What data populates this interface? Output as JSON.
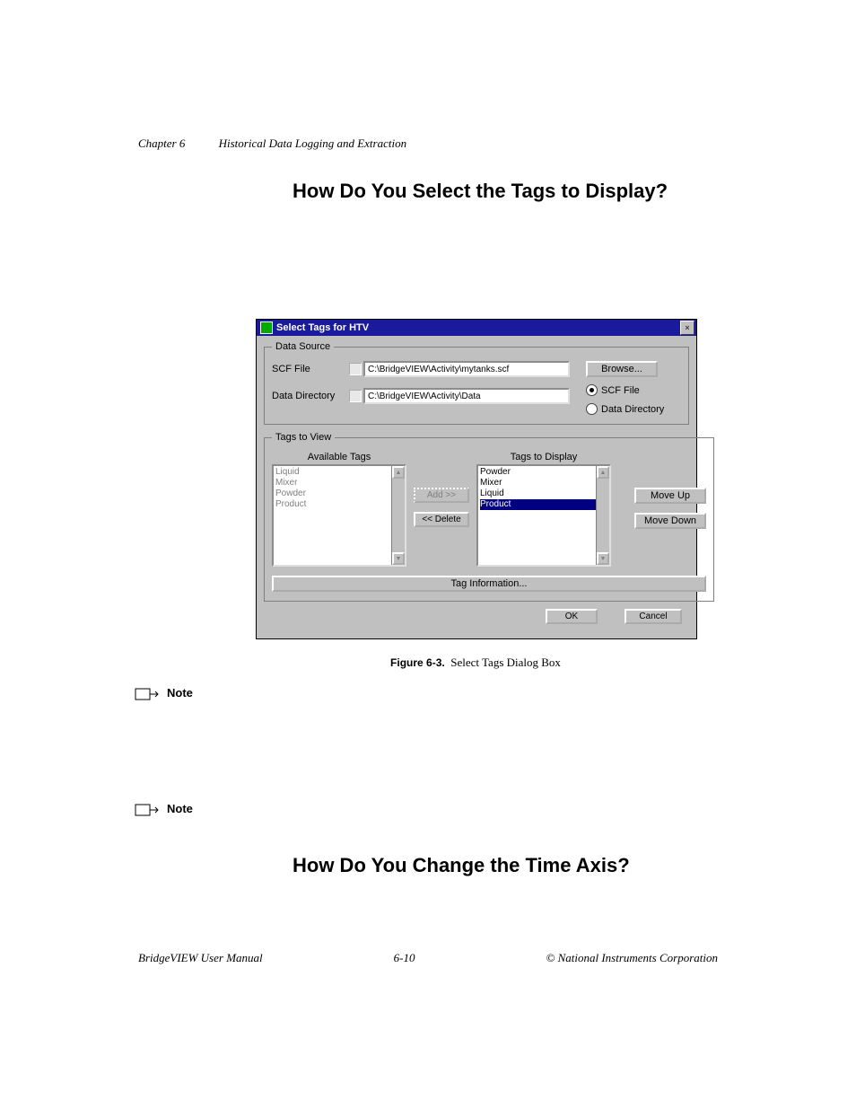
{
  "header": {
    "chapter": "Chapter 6",
    "title": "Historical Data Logging and Extraction"
  },
  "section1": {
    "heading": "How Do You Select the Tags to Display?"
  },
  "dialog": {
    "title": "Select Tags for HTV",
    "data_source": {
      "legend": "Data Source",
      "scf_label": "SCF File",
      "scf_path": "C:\\BridgeVIEW\\Activity\\mytanks.scf",
      "data_dir_label": "Data Directory",
      "data_dir_path": "C:\\BridgeVIEW\\Activity\\Data",
      "browse": "Browse...",
      "radio_scf": "SCF File",
      "radio_dir": "Data Directory"
    },
    "tags_view": {
      "legend": "Tags to View",
      "available_header": "Available Tags",
      "display_header": "Tags to Display",
      "available": [
        "Liquid",
        "Mixer",
        "Powder",
        "Product"
      ],
      "display": [
        "Powder",
        "Mixer",
        "Liquid",
        "Product"
      ],
      "add": "Add >>",
      "delete": "<< Delete",
      "move_up": "Move Up",
      "move_down": "Move Down",
      "tag_info": "Tag Information..."
    },
    "ok": "OK",
    "cancel": "Cancel"
  },
  "figure": {
    "label": "Figure 6-3.",
    "caption": "Select Tags Dialog Box"
  },
  "notes": {
    "label": "Note"
  },
  "section2": {
    "heading": "How Do You Change the Time Axis?"
  },
  "footer": {
    "left": "BridgeVIEW User Manual",
    "center": "6-10",
    "right": "© National Instruments Corporation"
  }
}
